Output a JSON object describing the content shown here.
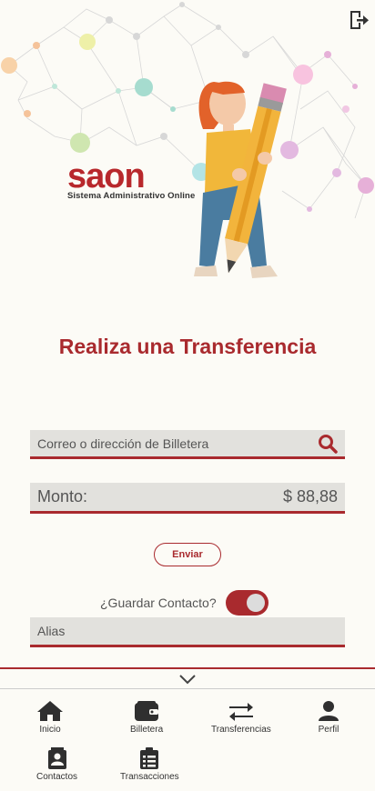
{
  "brand": {
    "name": "saon",
    "tagline": "Sistema Administrativo Online",
    "color": "#b8282c"
  },
  "header": {
    "logout_icon": "logout-icon"
  },
  "main": {
    "title": "Realiza una Transferencia",
    "search": {
      "placeholder": "Correo o dirección de Billetera",
      "icon": "search-icon"
    },
    "amount": {
      "label": "Monto:",
      "value": "$ 88,88"
    },
    "send_label": "Enviar",
    "save_contact": {
      "label": "¿Guardar Contacto?",
      "checked": true
    },
    "alias": {
      "placeholder": "Alias"
    }
  },
  "nav": {
    "items": [
      {
        "label": "Inicio",
        "icon": "home-icon"
      },
      {
        "label": "Billetera",
        "icon": "wallet-icon"
      },
      {
        "label": "Transferencias",
        "icon": "transfer-icon"
      },
      {
        "label": "Perfil",
        "icon": "user-icon"
      },
      {
        "label": "Contactos",
        "icon": "contacts-icon"
      },
      {
        "label": "Transacciones",
        "icon": "transactions-icon"
      }
    ]
  },
  "colors": {
    "accent": "#a92a2e",
    "background": "#fcfbf6",
    "field": "#e2e1dd"
  }
}
